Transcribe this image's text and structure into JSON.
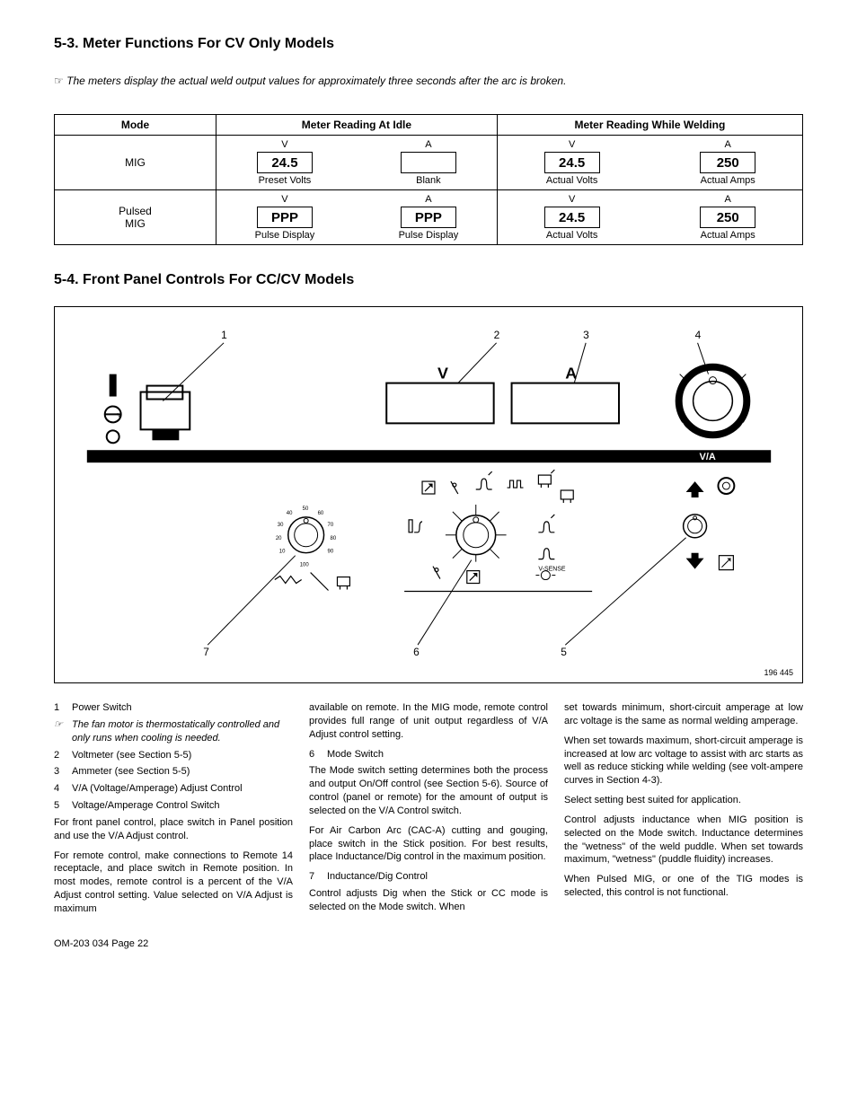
{
  "section53": {
    "title": "5-3.   Meter Functions For CV Only Models",
    "note": "The meters display the actual weld output values for approximately three seconds after the arc is broken.",
    "note_icon": "☞",
    "table": {
      "headers": [
        "Mode",
        "Meter Reading At Idle",
        "Meter Reading While Welding"
      ],
      "rows": [
        {
          "mode": "MIG",
          "idle": [
            {
              "t": "V",
              "v": "24.5",
              "b": "Preset Volts"
            },
            {
              "t": "A",
              "v": "",
              "b": "Blank"
            }
          ],
          "weld": [
            {
              "t": "V",
              "v": "24.5",
              "b": "Actual Volts"
            },
            {
              "t": "A",
              "v": "250",
              "b": "Actual Amps"
            }
          ]
        },
        {
          "mode": "Pulsed\nMIG",
          "idle": [
            {
              "t": "V",
              "v": "PPP",
              "b": "Pulse Display"
            },
            {
              "t": "A",
              "v": "PPP",
              "b": "Pulse Display"
            }
          ],
          "weld": [
            {
              "t": "V",
              "v": "24.5",
              "b": "Actual Volts"
            },
            {
              "t": "A",
              "v": "250",
              "b": "Actual Amps"
            }
          ]
        }
      ]
    }
  },
  "section54": {
    "title": "5-4.   Front Panel Controls For CC/CV Models",
    "ref": "196 445",
    "callouts": [
      "1",
      "2",
      "3",
      "4",
      "5",
      "6",
      "7"
    ],
    "panel_labels": {
      "v": "V",
      "a": "A",
      "va": "V/A",
      "vsense": "V-SENSE",
      "dial": [
        "10",
        "20",
        "30",
        "40",
        "50",
        "60",
        "70",
        "80",
        "90",
        "100"
      ]
    }
  },
  "legend": [
    {
      "n": "1",
      "t": "Power Switch"
    },
    {
      "n": "☞",
      "t": "The fan motor is thermostatically controlled and only runs when cooling is needed.",
      "italic": true
    },
    {
      "n": "2",
      "t": "Voltmeter (see Section 5-5)"
    },
    {
      "n": "3",
      "t": "Ammeter (see Section 5-5)"
    },
    {
      "n": "4",
      "t": "V/A (Voltage/Amperage) Adjust Control"
    },
    {
      "n": "5",
      "t": "Voltage/Amperage Control Switch"
    }
  ],
  "body": {
    "p1": "For front panel control, place switch in Panel position and use the V/A Adjust control.",
    "p2": "For remote control, make connections to Remote 14 receptacle, and place switch in Remote position. In most modes, remote control is a percent of the V/A Adjust control setting. Value selected on V/A Adjust is maximum",
    "p3": "available on remote. In the MIG mode, remote control provides full range of unit output regardless of V/A Adjust  control setting.",
    "l6n": "6",
    "l6t": "Mode Switch",
    "p4": "The Mode switch setting determines both the process and output On/Off control (see Section 5-6). Source of control (panel or remote) for the amount of output is selected on the V/A Control switch.",
    "p5": "For Air Carbon Arc (CAC-A) cutting and gouging, place switch in the Stick position. For best results, place Inductance/Dig control in the maximum position.",
    "l7n": "7",
    "l7t": "Inductance/Dig Control",
    "p6": "Control adjusts Dig when the Stick or CC mode is selected on the Mode switch. When",
    "p7": "set towards minimum, short-circuit amperage at low arc voltage is the same as normal welding amperage.",
    "p8": "When set towards maximum, short-circuit amperage is increased at low arc voltage to assist with arc starts as well as reduce sticking while welding (see volt-ampere curves in Section 4-3).",
    "p9": "Select setting best suited for application.",
    "p10": "Control adjusts inductance when MIG position is selected on the Mode switch. Inductance determines the \"wetness\" of the weld puddle. When set towards maximum, \"wetness\" (puddle fluidity) increases.",
    "p11": "When Pulsed MIG, or one of the TIG modes is selected, this control is not functional."
  },
  "footer": "OM-203 034 Page 22"
}
